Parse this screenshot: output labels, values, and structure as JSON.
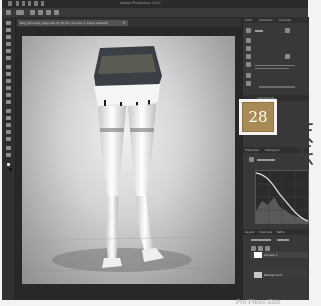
{
  "app": {
    "window_title": "Adobe Photoshop 2020",
    "doc_tab": "Neg_Stocking_Legs.psd @ 33.3% (Curves 1, Layer Mask/8)"
  },
  "panels": {
    "tabs_top": [
      "Color",
      "Swatches",
      "Libraries"
    ],
    "tabs_adjust": [
      "Adjustments",
      "Styles"
    ],
    "tabs_props": [
      "Properties",
      "Histogram"
    ],
    "tabs_layers": [
      "Layers",
      "Channels",
      "Paths"
    ]
  },
  "layers": {
    "items": [
      {
        "name": "Curves 1"
      },
      {
        "name": "Background"
      }
    ]
  },
  "badge": {
    "number": "28",
    "color": "#a88b54"
  },
  "watermark": {
    "text": "Pro Photo Edit"
  },
  "icons": {
    "close": "close-icon",
    "move": "move-tool-icon",
    "curves": "curves-icon"
  },
  "colors": {
    "ui_dark": "#323232",
    "panel": "#383838",
    "accent": "#a88b54"
  }
}
